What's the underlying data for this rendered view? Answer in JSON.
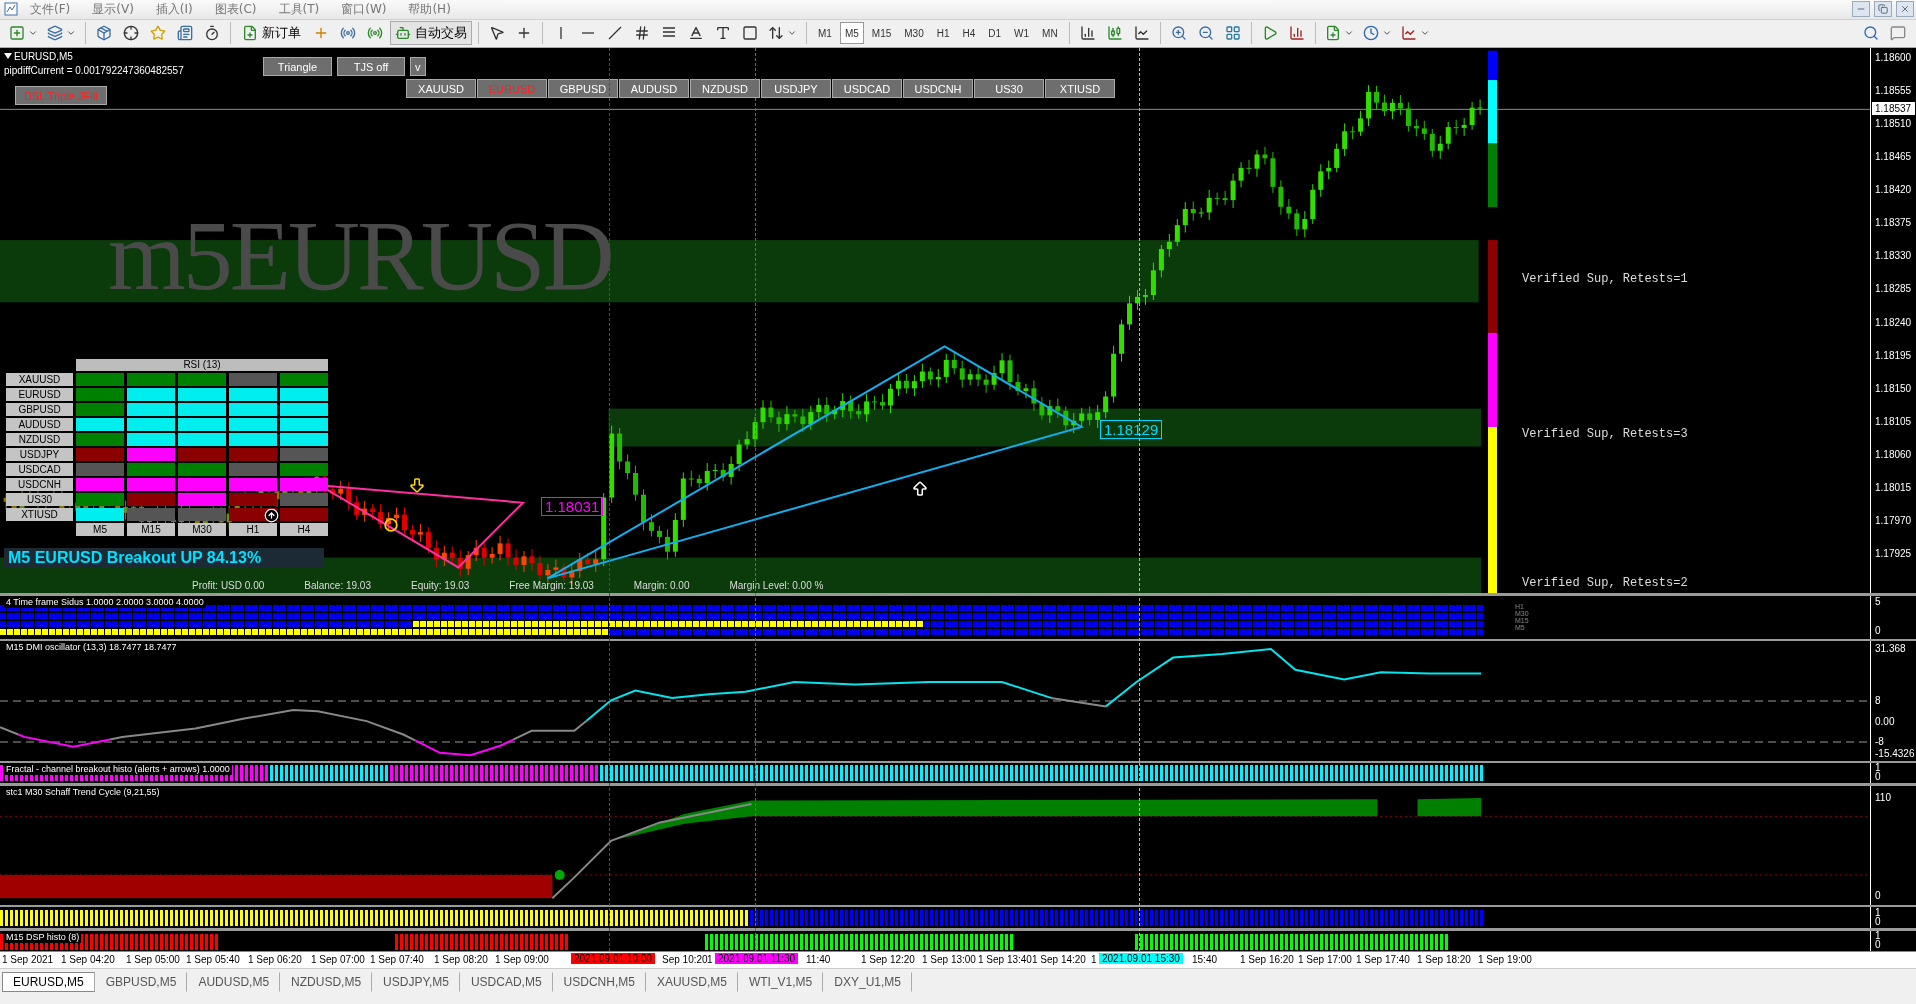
{
  "menu": [
    "文件(F)",
    "显示(V)",
    "插入(I)",
    "图表(C)",
    "工具(T)",
    "窗口(W)",
    "帮助(H)"
  ],
  "toolbar": {
    "new_order": "新订单",
    "auto_trading": "自动交易",
    "timeframes": [
      {
        "label": "M1",
        "selected": false
      },
      {
        "label": "M5",
        "selected": true
      },
      {
        "label": "M15",
        "selected": false
      },
      {
        "label": "M30",
        "selected": false
      },
      {
        "label": "H1",
        "selected": false
      },
      {
        "label": "H4",
        "selected": false
      },
      {
        "label": "D1",
        "selected": false
      },
      {
        "label": "W1",
        "selected": false
      },
      {
        "label": "MN",
        "selected": false
      }
    ]
  },
  "chart": {
    "symbol": "EURUSD,M5",
    "pipdiff": "pipdiffCurrent = 0.001792247360482557",
    "watermark": "m5EURUSD",
    "pattern_buttons": [
      "Triangle",
      "TJS off",
      "v"
    ],
    "filter_button": "DSL Triple JFilt",
    "symbols": [
      {
        "label": "XAUUSD",
        "selected": false
      },
      {
        "label": "EURUSD",
        "selected": true
      },
      {
        "label": "GBPUSD",
        "selected": false
      },
      {
        "label": "AUDUSD",
        "selected": false
      },
      {
        "label": "NZDUSD",
        "selected": false
      },
      {
        "label": "USDJPY",
        "selected": false
      },
      {
        "label": "USDCAD",
        "selected": false
      },
      {
        "label": "USDCNH",
        "selected": false
      },
      {
        "label": "US30",
        "selected": false
      },
      {
        "label": "XTIUSD",
        "selected": false
      }
    ],
    "rsi_panel": {
      "title": "RSI (13)",
      "columns": [
        "M5",
        "M15",
        "M30",
        "H1",
        "H4"
      ],
      "rows": [
        {
          "symbol": "XAUUSD",
          "cells": [
            {
              "color": "#008000"
            },
            {
              "color": "#008000"
            },
            {
              "color": "#008000"
            },
            {
              "color": "#555555"
            },
            {
              "color": "#008000"
            }
          ]
        },
        {
          "symbol": "EURUSD",
          "cells": [
            {
              "color": "#008000"
            },
            {
              "color": "#00eeee"
            },
            {
              "color": "#00eeee"
            },
            {
              "color": "#00eeee"
            },
            {
              "color": "#00eeee"
            }
          ]
        },
        {
          "symbol": "GBPUSD",
          "cells": [
            {
              "color": "#008000"
            },
            {
              "color": "#00eeee"
            },
            {
              "color": "#00eeee"
            },
            {
              "color": "#00eeee"
            },
            {
              "color": "#00eeee"
            }
          ]
        },
        {
          "symbol": "AUDUSD",
          "cells": [
            {
              "color": "#00eeee"
            },
            {
              "color": "#00eeee"
            },
            {
              "color": "#00eeee"
            },
            {
              "color": "#00eeee"
            },
            {
              "color": "#00eeee"
            }
          ]
        },
        {
          "symbol": "NZDUSD",
          "cells": [
            {
              "color": "#008000"
            },
            {
              "color": "#00eeee"
            },
            {
              "color": "#00eeee"
            },
            {
              "color": "#00eeee"
            },
            {
              "color": "#00eeee"
            }
          ]
        },
        {
          "symbol": "USDJPY",
          "cells": [
            {
              "color": "#8b0000"
            },
            {
              "color": "#ff00ff"
            },
            {
              "color": "#8b0000"
            },
            {
              "color": "#8b0000"
            },
            {
              "color": "#555555"
            }
          ]
        },
        {
          "symbol": "USDCAD",
          "cells": [
            {
              "color": "#555555"
            },
            {
              "color": "#008000"
            },
            {
              "color": "#008000"
            },
            {
              "color": "#555555"
            },
            {
              "color": "#008000"
            }
          ]
        },
        {
          "symbol": "USDCNH",
          "cells": [
            {
              "color": "#ff00ff"
            },
            {
              "color": "#ff00ff"
            },
            {
              "color": "#ff00ff"
            },
            {
              "color": "#ff00ff"
            },
            {
              "color": "#ff00ff"
            }
          ]
        },
        {
          "symbol": "US30",
          "cells": [
            {
              "color": "#008000"
            },
            {
              "color": "#8b0000"
            },
            {
              "color": "#ff00ff"
            },
            {
              "color": "#8b0000"
            },
            {
              "color": "#555555"
            }
          ]
        },
        {
          "symbol": "XTIUSD",
          "cells": [
            {
              "color": "#00eeee"
            },
            {
              "color": "#555555"
            },
            {
              "color": "#555555"
            },
            {
              "color": "#8b0000"
            },
            {
              "color": "#8b0000"
            }
          ]
        }
      ]
    },
    "signal": "M5 EURUSD Breakout UP 84.13%",
    "account": [
      "Profit: USD 0.00",
      "Balance: 19.03",
      "Equity: 19.03",
      "Free Margin: 19.03",
      "Margin: 0.00",
      "Margin Level: 0.00 %"
    ],
    "triangle_price": "1.18031",
    "wedge_price": "1.18129",
    "zones": [
      "Verified Sup, Retests=1",
      "Verified Sup, Retests=3",
      "Verified Sup, Retests=2"
    ],
    "price_axis": [
      "1.18600",
      "1.18555",
      "1.18510",
      "1.18465",
      "1.18420",
      "1.18375",
      "1.18330",
      "1.18285",
      "1.18240",
      "1.18195",
      "1.18150",
      "1.18105",
      "1.18060",
      "1.18015",
      "1.17970",
      "1.17925"
    ],
    "current_price": "1.18537"
  },
  "indicators": [
    {
      "kind": "sidus",
      "title": "4 Time frame Sidus 1.0000 2.0000 3.0000 4.0000",
      "labels": [
        "H1",
        "M30",
        "M15",
        "M5"
      ],
      "axis": [
        "5",
        "0"
      ]
    },
    {
      "kind": "dmi",
      "title": "M15 DMI oscillator (13,3) 18.7477 18.7477",
      "axis": [
        "31.368",
        "8",
        "0.00",
        "-8",
        "-15.4326"
      ]
    },
    {
      "kind": "fractal",
      "title": "Fractal - channel breakout histo (alerts + arrows) 1.0000",
      "axis": [
        "1",
        "0"
      ]
    },
    {
      "kind": "stc",
      "title": "stc1 M30 Schaff Trend Cycle (9,21,55)",
      "axis": [
        "110",
        "0"
      ]
    },
    {
      "kind": "stripe",
      "axis": [
        "1",
        "0"
      ]
    },
    {
      "kind": "dsp",
      "title": "M15 DSP histo (8)",
      "axis": [
        "1",
        "0"
      ]
    }
  ],
  "time_axis": [
    {
      "kind": "tick",
      "label": "1 Sep 2021"
    },
    {
      "kind": "tick",
      "label": "1 Sep 04:20"
    },
    {
      "kind": "tick",
      "label": "1 Sep 05:00"
    },
    {
      "kind": "tick",
      "label": "1 Sep 05:40"
    },
    {
      "kind": "tick",
      "label": "1 Sep 06:20"
    },
    {
      "kind": "tick",
      "label": "1 Sep 07:00"
    },
    {
      "kind": "tick",
      "label": "1 Sep 07:40"
    },
    {
      "kind": "tick",
      "label": "1 Sep 08:20"
    },
    {
      "kind": "tick",
      "label": "1 Sep 09:00"
    },
    {
      "kind": "marker",
      "label": "2021.09.01 10:00",
      "color": "#ff0000"
    },
    {
      "kind": "tick",
      "label": "Sep 10:20"
    },
    {
      "kind": "tick",
      "label": "1"
    },
    {
      "kind": "marker",
      "label": "2021.09.01 11:30",
      "color": "#ff00ff"
    },
    {
      "kind": "tick",
      "label": "11:40"
    },
    {
      "kind": "tick",
      "label": "1 Sep 12:20"
    },
    {
      "kind": "tick",
      "label": "1 Sep 13:00"
    },
    {
      "kind": "tick",
      "label": "1 Sep 13:40"
    },
    {
      "kind": "tick",
      "label": "1 Sep 14:20"
    },
    {
      "kind": "tick",
      "label": "1"
    },
    {
      "kind": "marker",
      "label": "2021.09.01 15:30",
      "color": "#00ffff"
    },
    {
      "kind": "tick",
      "label": "15:40"
    },
    {
      "kind": "tick",
      "label": "1 Sep 16:20"
    },
    {
      "kind": "tick",
      "label": "1 Sep 17:00"
    },
    {
      "kind": "tick",
      "label": "1 Sep 17:40"
    },
    {
      "kind": "tick",
      "label": "1 Sep 18:20"
    },
    {
      "kind": "tick",
      "label": "1 Sep 19:00"
    }
  ],
  "tabs": [
    {
      "label": "EURUSD,M5",
      "selected": true
    },
    {
      "label": "GBPUSD,M5",
      "selected": false
    },
    {
      "label": "AUDUSD,M5",
      "selected": false
    },
    {
      "label": "NZDUSD,M5",
      "selected": false
    },
    {
      "label": "USDJPY,M5",
      "selected": false
    },
    {
      "label": "USDCAD,M5",
      "selected": false
    },
    {
      "label": "USDCNH,M5",
      "selected": false
    },
    {
      "label": "XAUUSD,M5",
      "selected": false
    },
    {
      "label": "WTI_V1,M5",
      "selected": false
    },
    {
      "label": "DXY_U1,M5",
      "selected": false
    }
  ]
}
